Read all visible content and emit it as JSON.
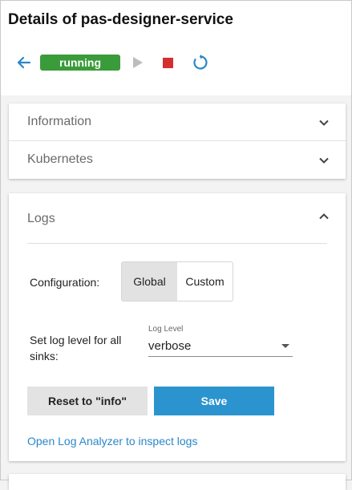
{
  "header": {
    "title": "Details of pas-designer-service",
    "status": "running",
    "icons": {
      "back": "arrow-left-icon",
      "play": "play-icon",
      "stop": "stop-icon",
      "restart": "restart-icon"
    }
  },
  "colors": {
    "status_running": "#3a9b3a",
    "accent": "#2b94cf",
    "stop": "#d32f2f",
    "link": "#2b87c8"
  },
  "sections": {
    "information": {
      "label": "Information",
      "expanded": false
    },
    "kubernetes": {
      "label": "Kubernetes",
      "expanded": false
    },
    "logs": {
      "label": "Logs",
      "expanded": true,
      "configuration_label": "Configuration:",
      "configuration_options": [
        "Global",
        "Custom"
      ],
      "configuration_selected": "Global",
      "level_label": "Set log level for all sinks:",
      "level_caption": "Log Level",
      "level_value": "verbose",
      "reset_button": "Reset to \"info\"",
      "save_button": "Save",
      "analyzer_link": "Open Log Analyzer to inspect logs"
    }
  }
}
